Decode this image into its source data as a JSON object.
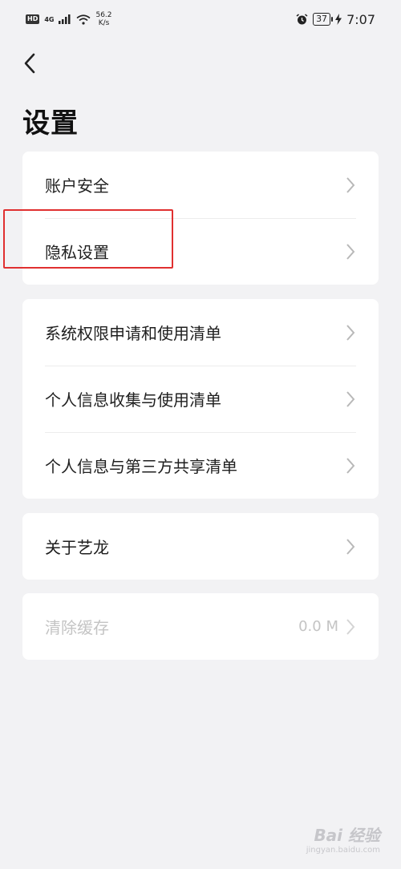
{
  "status_bar": {
    "hd": "HD",
    "network": "4G",
    "speed_value": "56.2",
    "speed_unit": "K/s",
    "battery": "37",
    "time": "7:07"
  },
  "header": {
    "title": "设置"
  },
  "groups": [
    {
      "items": [
        {
          "label": "账户安全"
        },
        {
          "label": "隐私设置"
        }
      ]
    },
    {
      "items": [
        {
          "label": "系统权限申请和使用清单"
        },
        {
          "label": "个人信息收集与使用清单"
        },
        {
          "label": "个人信息与第三方共享清单"
        }
      ]
    },
    {
      "items": [
        {
          "label": "关于艺龙"
        }
      ]
    },
    {
      "items": [
        {
          "label": "清除缓存",
          "value": "0.0 M",
          "disabled": true
        }
      ]
    }
  ],
  "watermark": {
    "main": "Bai 经验",
    "sub": "jingyan.baidu.com"
  },
  "colors": {
    "background": "#f2f2f4",
    "card": "#ffffff",
    "highlight": "#e03030",
    "disabled_text": "#c4c4c4"
  }
}
